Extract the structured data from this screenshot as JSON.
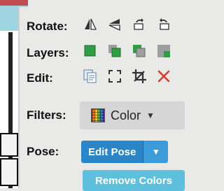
{
  "toolbar": {
    "rotate_label": "Rotate:",
    "layers_label": "Layers:",
    "edit_label": "Edit:",
    "filters_label": "Filters:",
    "pose_label": "Pose:",
    "filter_button_label": "Color",
    "edit_pose_label": "Edit Pose",
    "remove_colors_label": "Remove Colors"
  },
  "icons": {
    "rotate": [
      "flip-horizontal-icon",
      "flip-vertical-icon",
      "rotate-left-icon",
      "rotate-right-icon"
    ],
    "layers": [
      "bring-to-front-icon",
      "bring-forward-icon",
      "send-backward-icon",
      "send-to-back-icon"
    ],
    "edit": [
      "duplicate-icon",
      "fullscreen-icon",
      "crop-icon",
      "delete-icon"
    ]
  },
  "colors": {
    "panel_bg": "#e9e9e7",
    "primary_blue": "#2a86c8",
    "info_blue": "#5fc0de",
    "delete_red": "#d63b2f",
    "layer_green": "#2f9e44"
  }
}
